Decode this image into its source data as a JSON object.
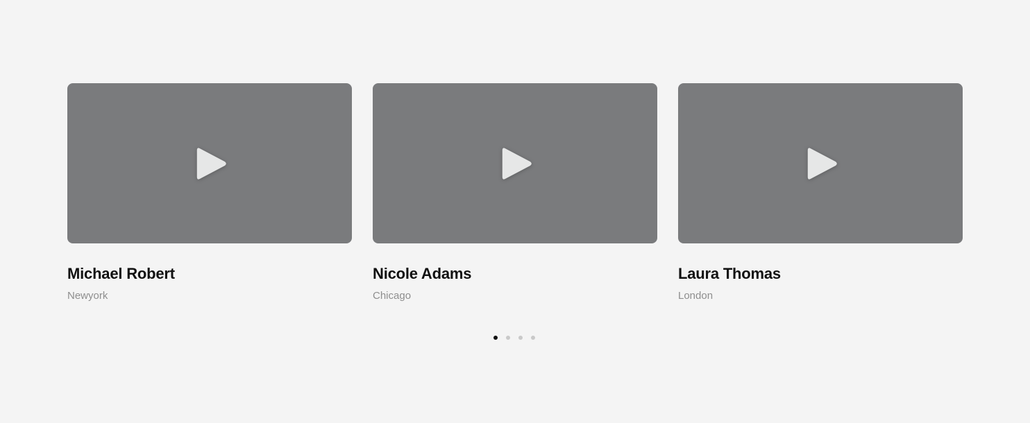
{
  "cards": [
    {
      "name": "Michael Robert",
      "location": "Newyork"
    },
    {
      "name": "Nicole Adams",
      "location": "Chicago"
    },
    {
      "name": "Laura Thomas",
      "location": "London"
    }
  ],
  "pagination": {
    "total": 4,
    "active_index": 0
  },
  "colors": {
    "background": "#f4f4f4",
    "thumbnail": "#7a7b7d",
    "play_icon": "#e6e7e7",
    "name_text": "#111111",
    "location_text": "#8e8e8e",
    "dot_active": "#111111",
    "dot_inactive": "#c9c9c9"
  },
  "icons": {
    "play": "play-icon"
  }
}
